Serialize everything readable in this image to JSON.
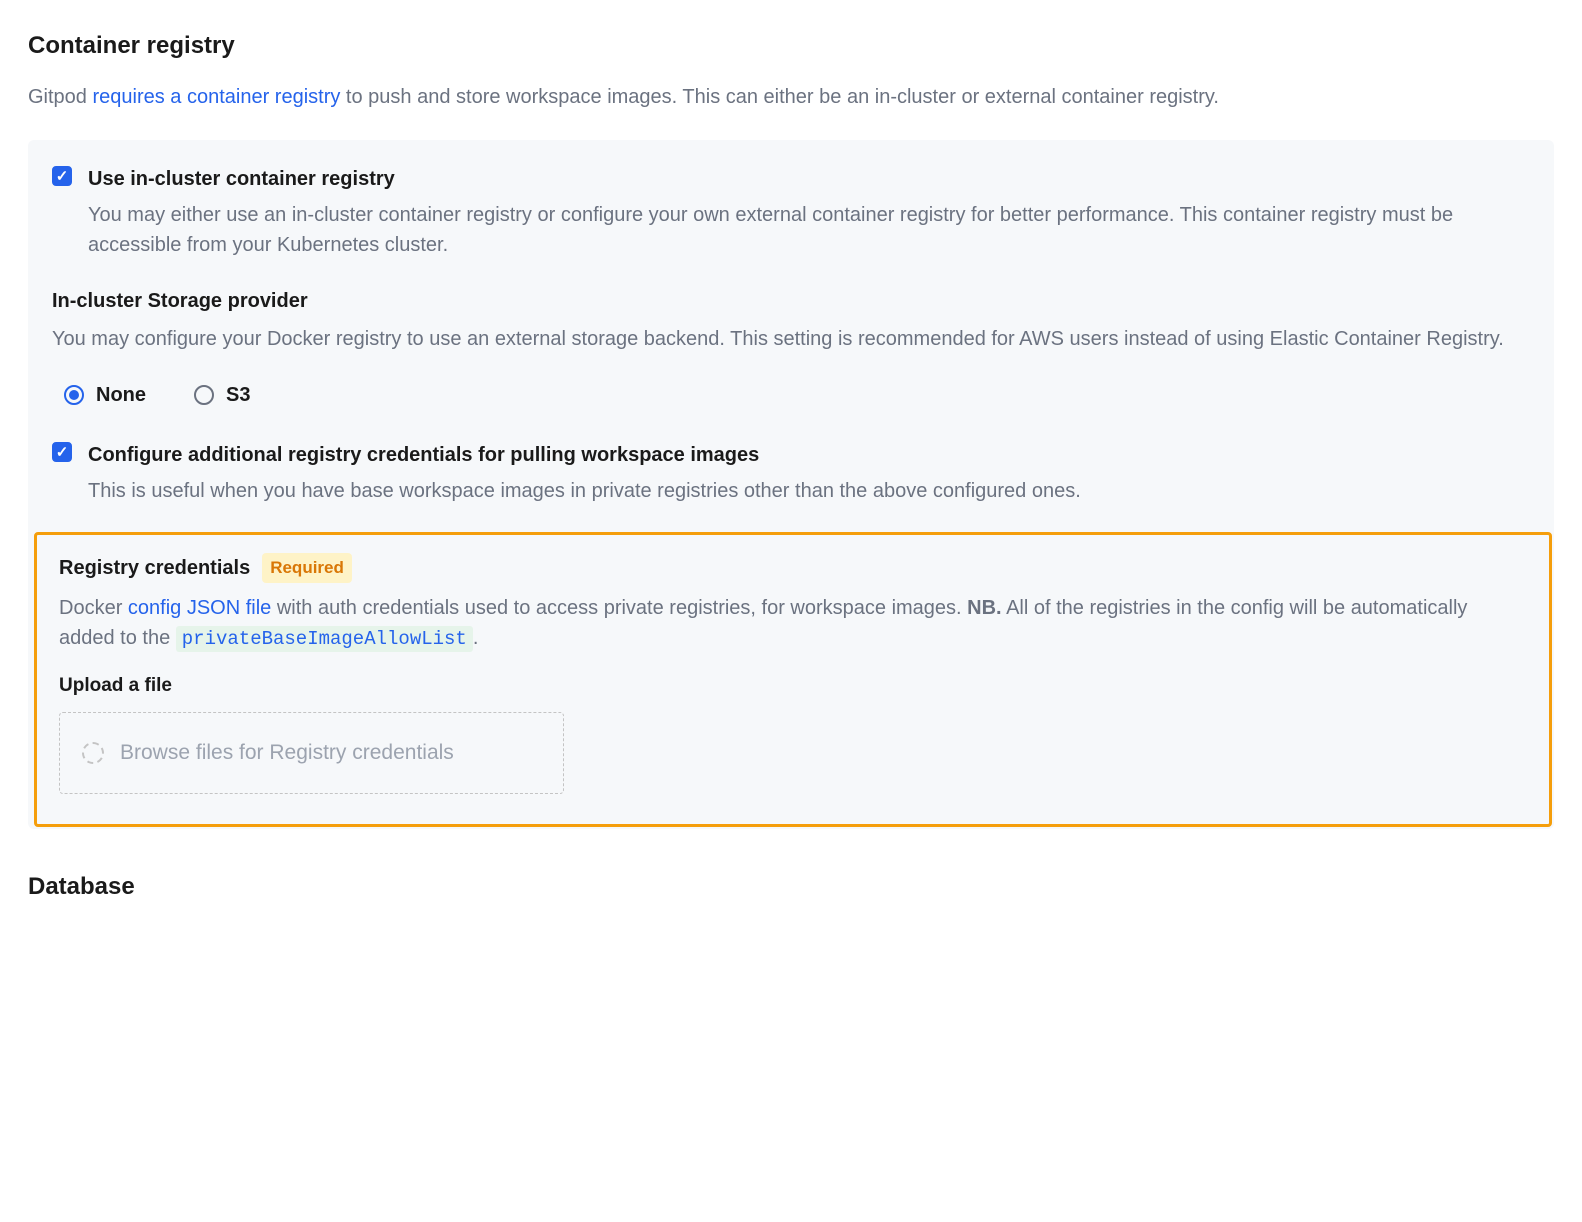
{
  "heading": "Container registry",
  "intro": {
    "prefix": "Gitpod ",
    "link": "requires a container registry",
    "suffix": " to push and store workspace images. This can either be an in-cluster or external container registry."
  },
  "option1": {
    "title": "Use in-cluster container registry",
    "desc": "You may either use an in-cluster container registry or configure your own external container registry for better performance. This container registry must be accessible from your Kubernetes cluster."
  },
  "storage": {
    "title": "In-cluster Storage provider",
    "desc": "You may configure your Docker registry to use an external storage backend. This setting is recommended for AWS users instead of using Elastic Container Registry.",
    "options": {
      "none": "None",
      "s3": "S3"
    }
  },
  "option2": {
    "title": "Configure additional registry credentials for pulling workspace images",
    "desc": "This is useful when you have base workspace images in private registries other than the above configured ones."
  },
  "registryCreds": {
    "title": "Registry credentials",
    "badge": "Required",
    "descPrefix": "Docker ",
    "descLink": "config JSON file",
    "descMid": " with auth credentials used to access private registries, for workspace images. ",
    "nb": "NB.",
    "descEnd": " All of the registries in the config will be automatically added to the ",
    "code": "privateBaseImageAllowList",
    "descAfterCode": ".",
    "uploadTitle": "Upload a file",
    "dropzoneText": "Browse files for Registry credentials"
  },
  "databaseHeading": "Database"
}
